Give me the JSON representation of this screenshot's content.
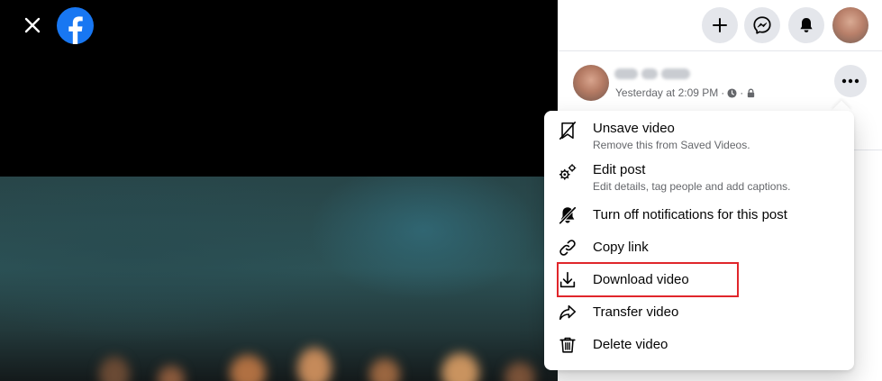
{
  "viewer": {
    "close_icon": "close-icon",
    "logo_icon": "facebook-logo-icon"
  },
  "top_bar": {
    "buttons": [
      {
        "name": "create",
        "icon": "plus-icon"
      },
      {
        "name": "messenger",
        "icon": "messenger-icon"
      },
      {
        "name": "notifications",
        "icon": "bell-icon"
      }
    ],
    "profile_icon": "profile-avatar"
  },
  "post": {
    "timestamp": "Yesterday at 2:09 PM",
    "separator": "·",
    "meta_icons": [
      "clock-icon",
      "lock-icon"
    ],
    "more_icon": "more-horizontal-icon"
  },
  "menu": {
    "items": [
      {
        "label": "Unsave video",
        "desc": "Remove this from Saved Videos.",
        "icon": "unsave-bookmark-icon"
      },
      {
        "label": "Edit post",
        "desc": "Edit details, tag people and add captions.",
        "icon": "gears-icon"
      },
      {
        "label": "Turn off notifications for this post",
        "desc": "",
        "icon": "bell-off-icon"
      },
      {
        "label": "Copy link",
        "desc": "",
        "icon": "link-icon"
      },
      {
        "label": "Download video",
        "desc": "",
        "icon": "download-icon"
      },
      {
        "label": "Transfer video",
        "desc": "",
        "icon": "share-arrow-icon"
      },
      {
        "label": "Delete video",
        "desc": "",
        "icon": "trash-icon"
      }
    ],
    "highlighted_item": "Download video"
  },
  "colors": {
    "facebook_blue": "#1877F2",
    "highlight_red": "#E0262B",
    "button_gray": "#E4E6EB",
    "secondary_text": "#65676B"
  }
}
